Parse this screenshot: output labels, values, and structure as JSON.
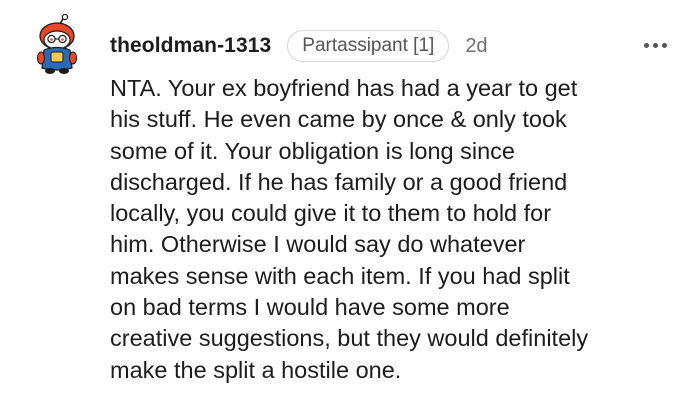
{
  "comment": {
    "username": "theoldman-1313",
    "flair": "Partassipant [1]",
    "timestamp": "2d",
    "more_icon": "more-horizontal-icon",
    "avatar_icon": "snoo-avatar-icon",
    "body_lines": [
      "NTA. Your ex boyfriend has had a year to get",
      "his stuff. He even came by once & only took",
      "some of it. Your obligation is long since",
      "discharged. If he has family or a good friend",
      "locally, you could give it to them to hold for",
      "him. Otherwise I would say do whatever",
      "makes sense with each item. If you had split",
      "on bad terms I would have some more",
      "creative suggestions, but they would definitely",
      "make the split a hostile one."
    ]
  },
  "colors": {
    "avatar_red": "#e8472b",
    "avatar_blue": "#2a6bb8",
    "text": "#1c1c1c",
    "muted": "#6f6f6f"
  }
}
